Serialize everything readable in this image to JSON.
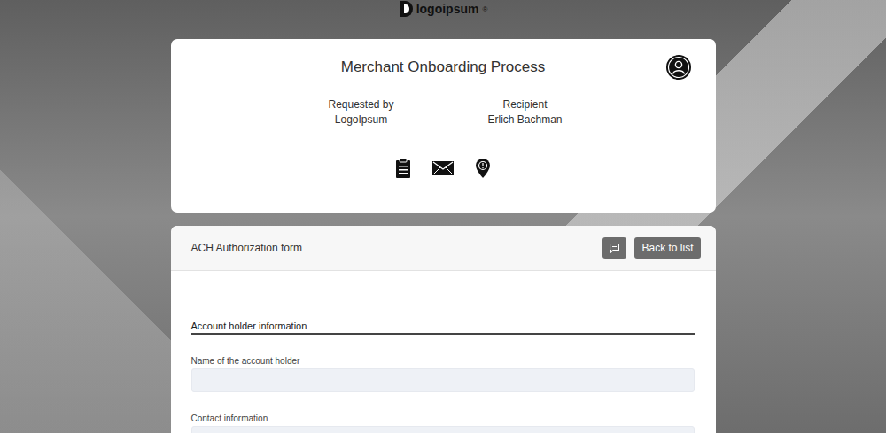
{
  "logo": {
    "text": "logoipsum",
    "mark": "®"
  },
  "header": {
    "title": "Merchant Onboarding Process",
    "parties": [
      {
        "label": "Requested by",
        "value": "LogoIpsum"
      },
      {
        "label": "Recipient",
        "value": "Erlich Bachman"
      }
    ]
  },
  "form": {
    "title": "ACH Authorization form",
    "back_button": "Back to list",
    "section": "Account holder information",
    "fields": [
      {
        "label": "Name of the account holder",
        "value": ""
      },
      {
        "label": "Contact information",
        "value": ""
      }
    ]
  }
}
